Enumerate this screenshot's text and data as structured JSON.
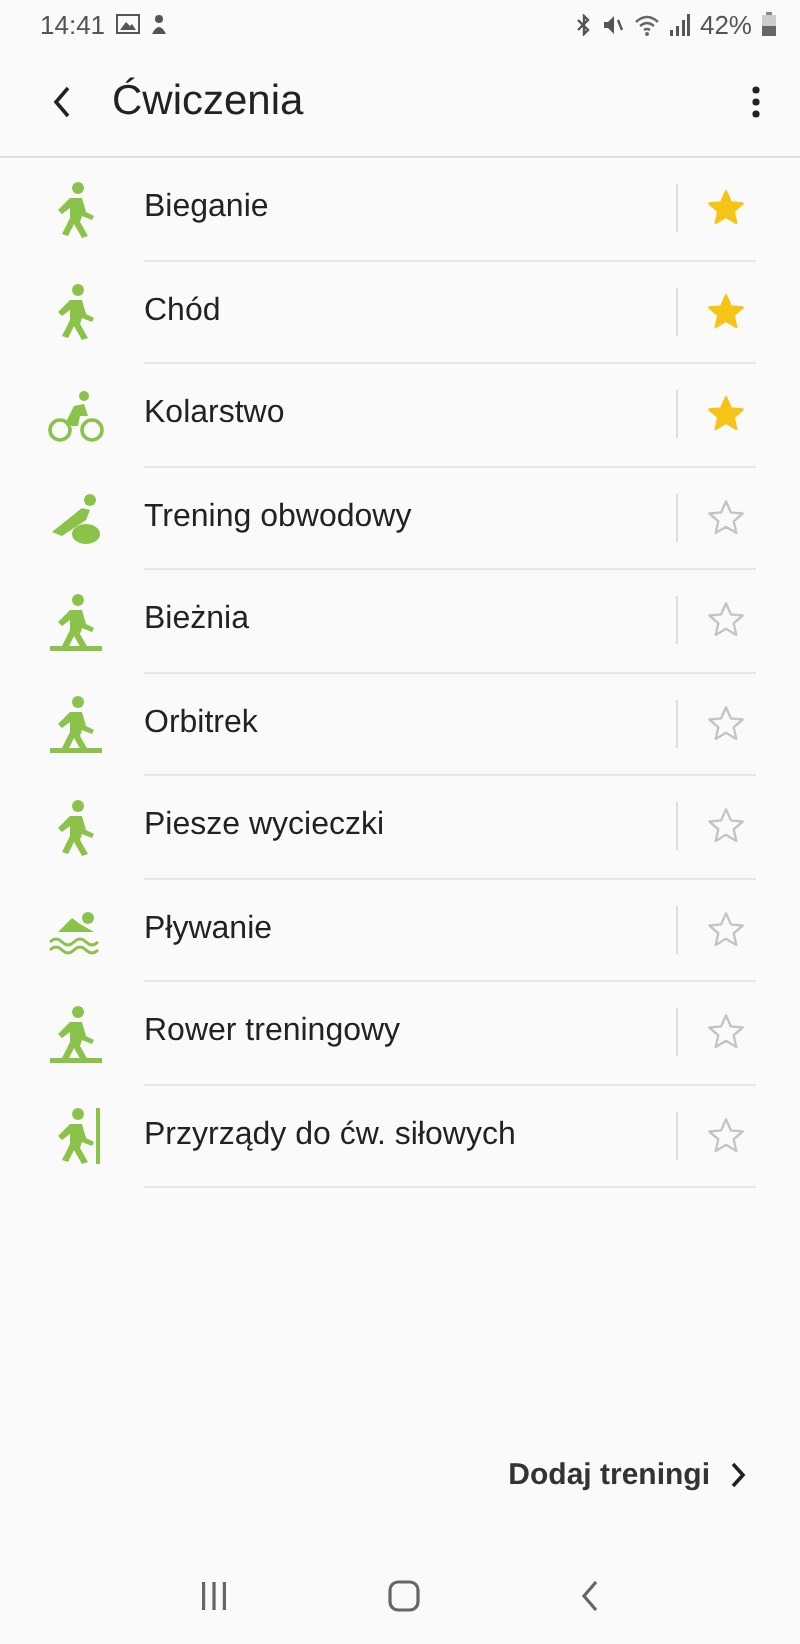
{
  "status_bar": {
    "time": "14:41",
    "battery": "42%"
  },
  "header": {
    "title": "Ćwiczenia"
  },
  "exercises": [
    {
      "name": "Bieganie",
      "favorite": true
    },
    {
      "name": "Chód",
      "favorite": true
    },
    {
      "name": "Kolarstwo",
      "favorite": true
    },
    {
      "name": "Trening obwodowy",
      "favorite": false
    },
    {
      "name": "Bieżnia",
      "favorite": false
    },
    {
      "name": "Orbitrek",
      "favorite": false
    },
    {
      "name": "Piesze wycieczki",
      "favorite": false
    },
    {
      "name": "Pływanie",
      "favorite": false
    },
    {
      "name": "Rower treningowy",
      "favorite": false
    },
    {
      "name": "Przyrządy do ćw. siłowych",
      "favorite": false
    }
  ],
  "footer": {
    "link": "Dodaj treningi"
  }
}
